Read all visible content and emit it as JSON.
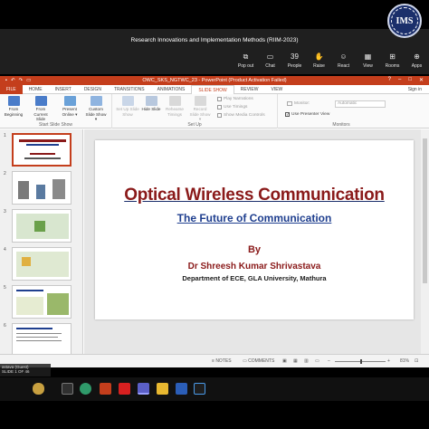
{
  "meeting": {
    "title": "Research Innovations and Implementation Methods (RIIM-2023)",
    "tools": [
      {
        "icon": "pop-out-icon",
        "label": "Pop out",
        "glyph": "⧉"
      },
      {
        "icon": "chat-icon",
        "label": "Chat",
        "glyph": "💬"
      },
      {
        "icon": "people-icon",
        "label": "People",
        "glyph": "39"
      },
      {
        "icon": "raise-hand-icon",
        "label": "Raise",
        "glyph": "✋"
      },
      {
        "icon": "react-icon",
        "label": "React",
        "glyph": "☺"
      },
      {
        "icon": "view-icon",
        "label": "View",
        "glyph": "▦"
      },
      {
        "icon": "rooms-icon",
        "label": "Rooms",
        "glyph": "⊞"
      },
      {
        "icon": "apps-icon",
        "label": "Apps",
        "glyph": "⊕"
      }
    ],
    "logo_text": "IMS"
  },
  "window": {
    "title": "OWC_SKS_NGTWC_23 - PowerPoint (Product Activation Failed)",
    "controls": [
      "?",
      "–",
      "□",
      "✕"
    ]
  },
  "ribbon_tabs": [
    "FILE",
    "HOME",
    "INSERT",
    "DESIGN",
    "TRANSITIONS",
    "ANIMATIONS",
    "SLIDE SHOW",
    "REVIEW",
    "VIEW"
  ],
  "active_tab": "SLIDE SHOW",
  "sign_in": "Sign in",
  "ribbon": {
    "start_group_label": "Start Slide Show",
    "setup_group_label": "Set Up",
    "monitors_group_label": "Monitors",
    "buttons": [
      {
        "label": "From Beginning"
      },
      {
        "label": "From Current Slide"
      },
      {
        "label": "Present Online ▾"
      },
      {
        "label": "Custom Slide Show ▾"
      },
      {
        "label": "Set Up Slide Show"
      },
      {
        "label": "Hide Slide"
      },
      {
        "label": "Rehearse Timings"
      },
      {
        "label": "Record Slide Show ▾"
      }
    ],
    "checks": [
      {
        "label": "Play Narrations"
      },
      {
        "label": "Use Timings"
      },
      {
        "label": "Show Media Controls"
      }
    ],
    "monitor_label": "Monitor:",
    "monitor_value": "Automatic",
    "presenter_view": "Use Presenter View"
  },
  "thumbnails": [
    "1",
    "2",
    "3",
    "4",
    "5",
    "6"
  ],
  "slide": {
    "title": "Optical Wireless Communication",
    "subtitle": "The Future of Communication",
    "by": "By",
    "author": "Dr Shreesh Kumar Shrivastava",
    "department": "Department of ECE, GLA University, Mathura"
  },
  "status": {
    "notes": "NOTES",
    "comments": "COMMENTS",
    "zoom": "81%"
  },
  "speaker": {
    "line1": "astava (Guest)",
    "line2": "SLIDE 1 OF 46"
  },
  "taskbar_icons": [
    "search-icon",
    "weather-icon",
    "file-explorer-icon",
    "edge-icon",
    "powerpoint-icon",
    "pdf-icon",
    "teams-icon",
    "folder-icon",
    "word-icon",
    "excel-icon"
  ],
  "colors": {
    "accent": "#c43e1c",
    "slide_title": "#8a1a1a",
    "slide_subtitle": "#1f3f8f"
  }
}
